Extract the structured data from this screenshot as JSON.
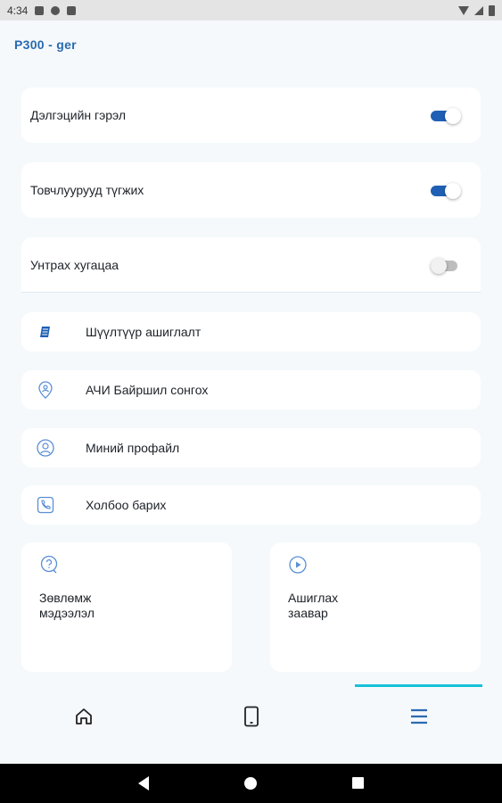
{
  "status_bar": {
    "time": "4:34"
  },
  "app": {
    "title": "P300 - ger"
  },
  "toggles": [
    {
      "label": "Дэлгэцийн гэрэл",
      "on": true
    },
    {
      "label": "Товчлуурууд түгжих",
      "on": true
    },
    {
      "label": "Унтрах хугацаа",
      "on": false
    }
  ],
  "menu": [
    {
      "label": "Шүүлтүүр ашиглалт",
      "icon": "filter-doc-icon"
    },
    {
      "label": "АЧИ Байршил сонгох",
      "icon": "location-pin-icon"
    },
    {
      "label": "Миний профайл",
      "icon": "profile-icon"
    },
    {
      "label": "Холбоо барих",
      "icon": "phone-icon"
    }
  ],
  "tiles": [
    {
      "label": "Зөвлөмж\nмэдээлэл",
      "icon": "help-chat-icon"
    },
    {
      "label": "Ашиглах\nзаавар",
      "icon": "play-circle-icon"
    }
  ],
  "bottom_nav": {
    "items": [
      "home-icon",
      "device-icon",
      "menu-icon"
    ],
    "active": "menu-icon"
  },
  "colors": {
    "accent": "#1f5fb4",
    "indicator": "#17c1d8",
    "title": "#2a6ab0",
    "background": "#f5f9fc"
  }
}
